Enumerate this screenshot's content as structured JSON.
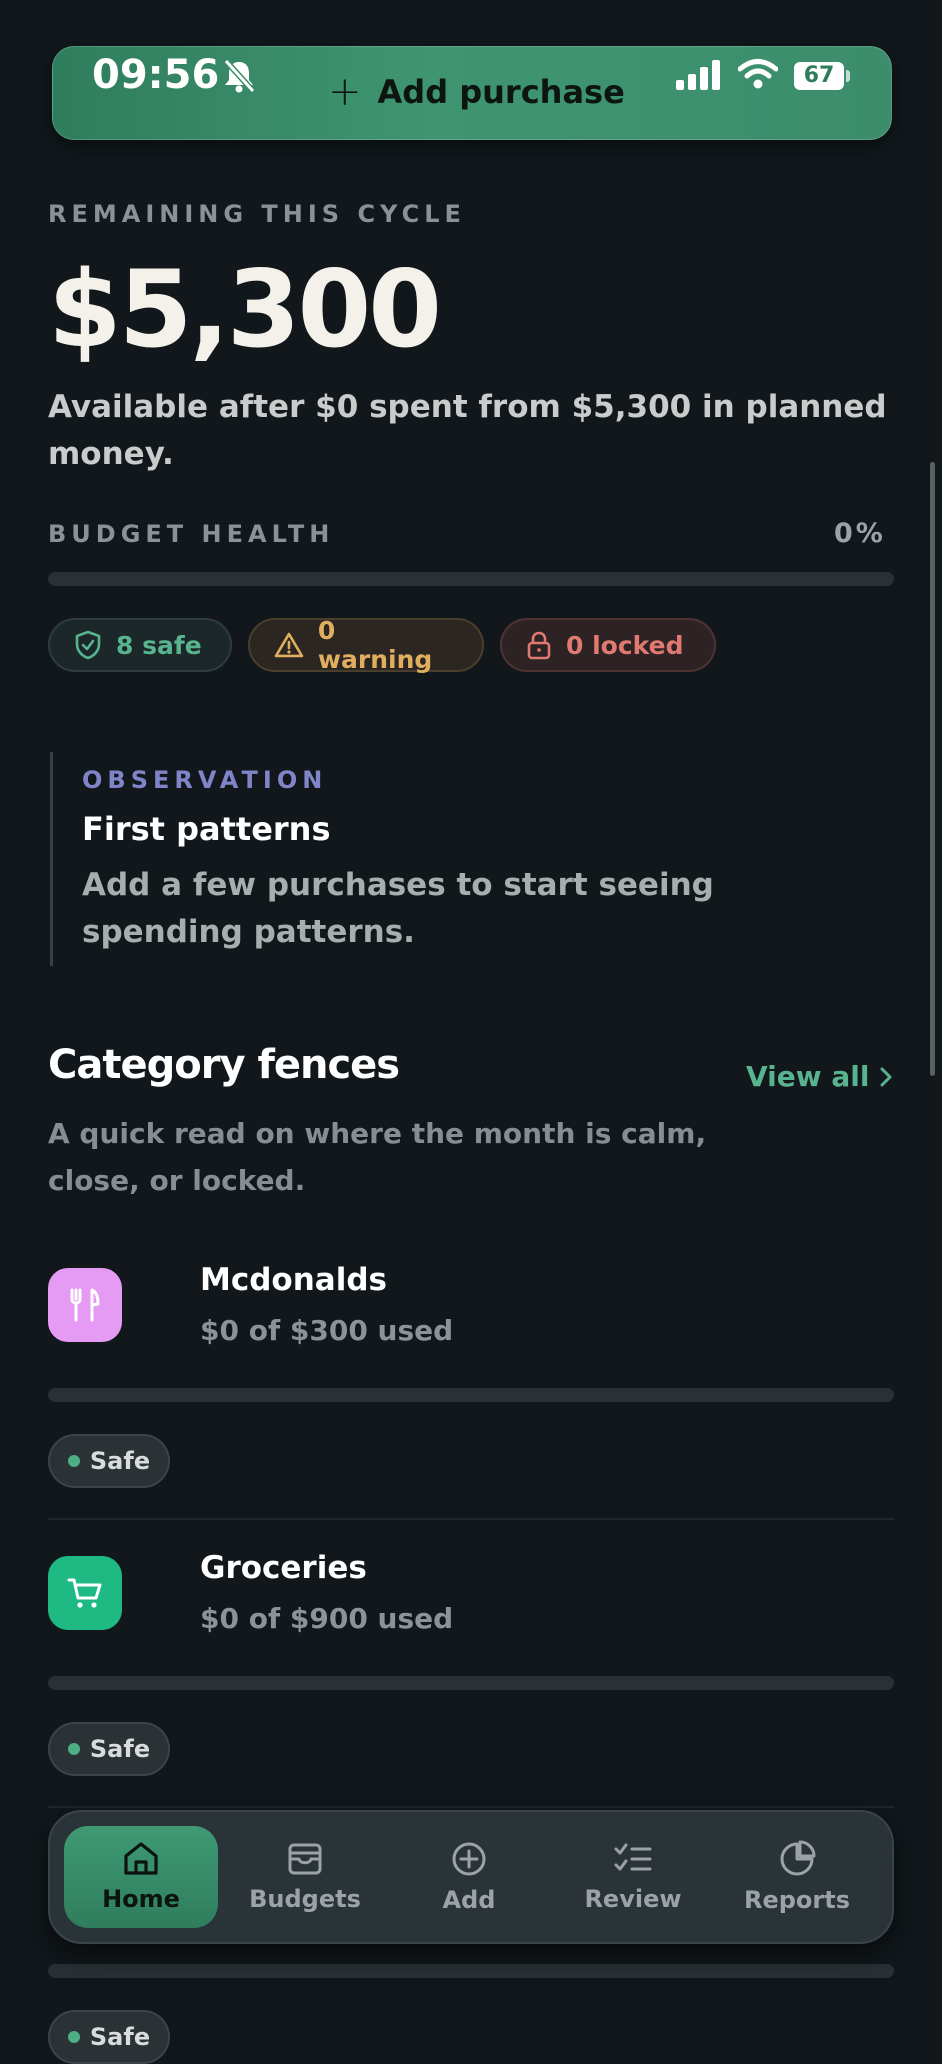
{
  "status_bar": {
    "time": "09:56",
    "battery": "67"
  },
  "top_action": {
    "label": "Add purchase"
  },
  "summary": {
    "eyebrow": "REMAINING THIS CYCLE",
    "amount": "$5,300",
    "description": "Available after $0 spent from $5,300 in planned money."
  },
  "budget_health": {
    "label": "BUDGET HEALTH",
    "percent_text": "0%",
    "progress": 0
  },
  "status_chips": {
    "safe": "8 safe",
    "warning": "0 warning",
    "locked": "0 locked"
  },
  "observation": {
    "label": "OBSERVATION",
    "title": "First patterns",
    "body": "Add a few purchases to start seeing spending patterns."
  },
  "categories": {
    "title": "Category fences",
    "view_all": "View all",
    "subtitle": "A quick read on where the month is calm, close, or locked.",
    "items": [
      {
        "name": "Mcdonalds",
        "used": "$0 of $300 used",
        "status": "Safe",
        "icon": "utensils-icon",
        "color": "#e59af3",
        "progress": 0
      },
      {
        "name": "Groceries",
        "used": "$0 of $900 used",
        "status": "Safe",
        "icon": "cart-icon",
        "color": "#1fba84",
        "progress": 0
      },
      {
        "status": "Safe",
        "progress": 0
      }
    ]
  },
  "tabbar": {
    "tabs": [
      {
        "label": "Home",
        "icon": "home-icon",
        "active": true
      },
      {
        "label": "Budgets",
        "icon": "wallet-icon",
        "active": false
      },
      {
        "label": "Add",
        "icon": "plus-circle-icon",
        "active": false
      },
      {
        "label": "Review",
        "icon": "checklist-icon",
        "active": false
      },
      {
        "label": "Reports",
        "icon": "pie-chart-icon",
        "active": false
      }
    ]
  },
  "colors": {
    "accent": "#3f9571",
    "background": "#11171b",
    "safe": "#58b48f",
    "warning": "#e1ad5e",
    "locked": "#e07a70"
  }
}
